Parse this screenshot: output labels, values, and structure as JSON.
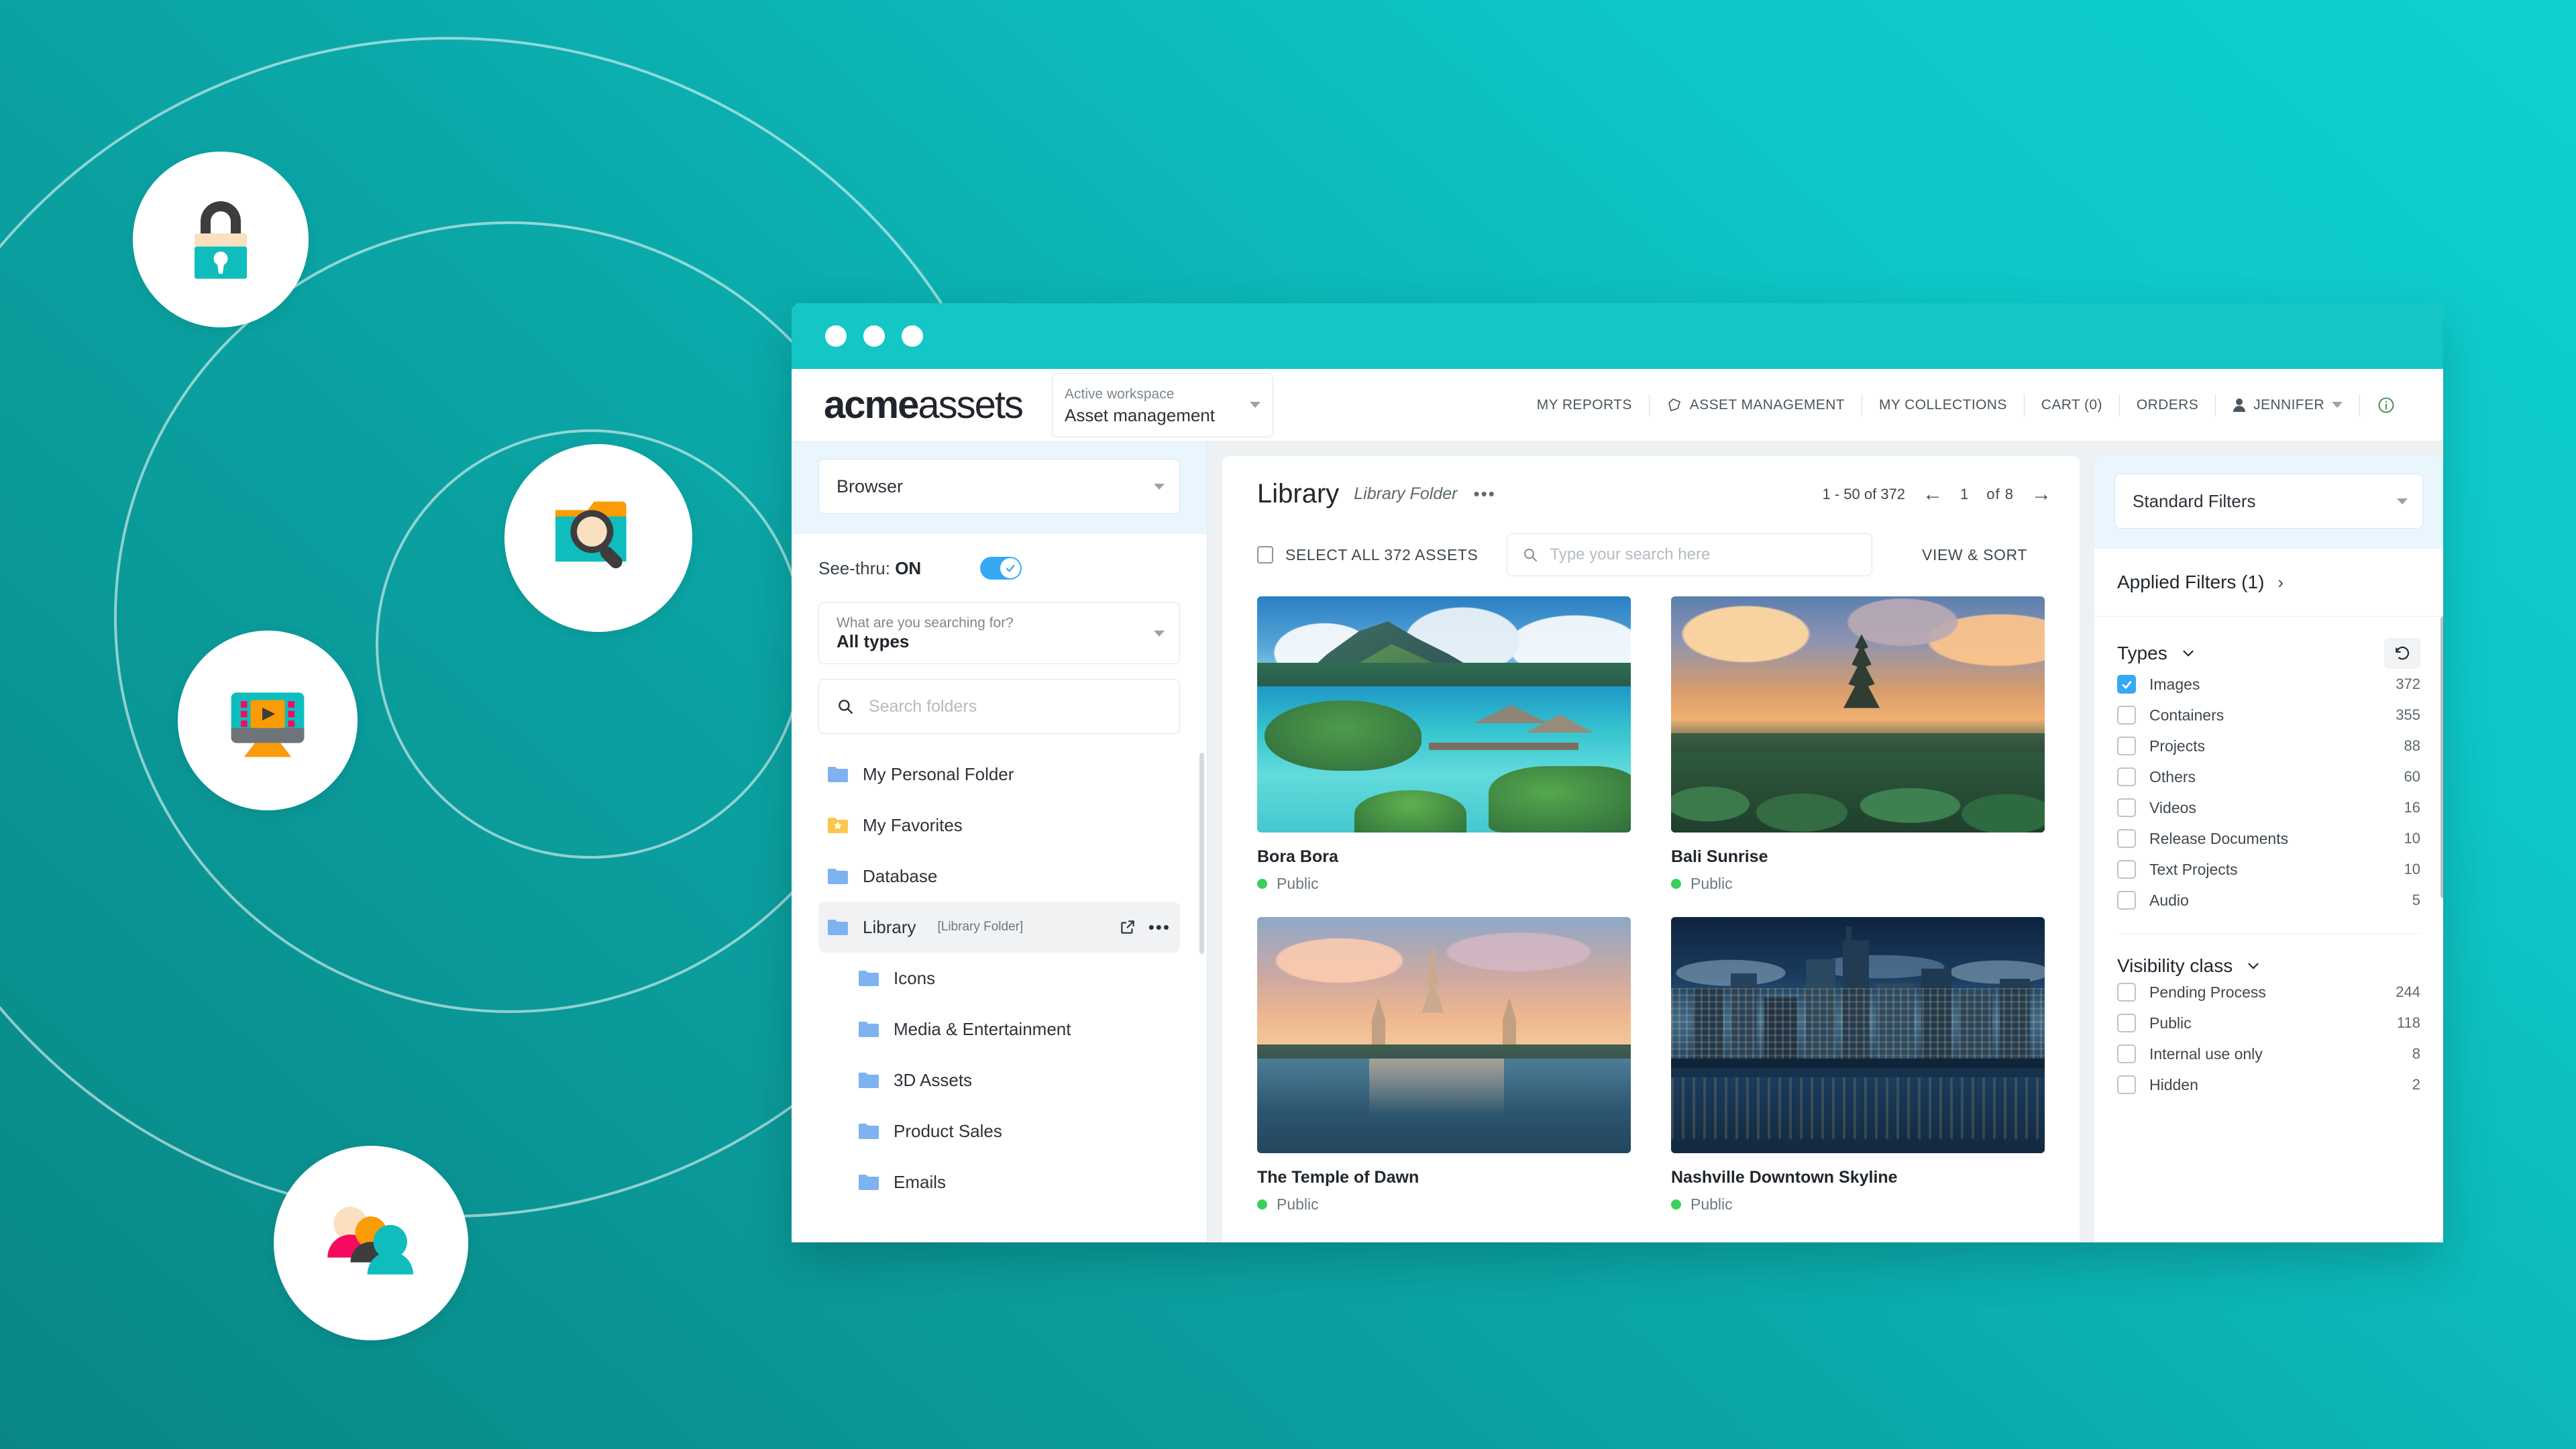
{
  "background": {
    "gradient_from": "#0a8686",
    "gradient_to": "#10cfcf",
    "accent_teal": "#14c6c6"
  },
  "badges": [
    {
      "name": "lock-icon",
      "label": "Secure access"
    },
    {
      "name": "folder-search-icon",
      "label": "Search assets"
    },
    {
      "name": "media-player-icon",
      "label": "Rich media"
    },
    {
      "name": "people-group-icon",
      "label": "Collaboration"
    }
  ],
  "window": {
    "traffic_lights": 3,
    "logo": {
      "bold": "acme",
      "light": "assets"
    },
    "workspace": {
      "label": "Active workspace",
      "value": "Asset management"
    },
    "topnav": [
      {
        "label": "MY REPORTS",
        "icon": null
      },
      {
        "label": "ASSET MANAGEMENT",
        "icon": "tag-icon"
      },
      {
        "label": "MY COLLECTIONS",
        "icon": null
      },
      {
        "label": "CART (0)",
        "icon": null
      },
      {
        "label": "ORDERS",
        "icon": null
      },
      {
        "label": "JENNIFER",
        "icon": "person-icon",
        "caret": true
      },
      {
        "label": "",
        "icon": "info-icon"
      }
    ]
  },
  "sidebar": {
    "browser_select": "Browser",
    "seethru": {
      "label": "See-thru:",
      "state": "ON",
      "on": true
    },
    "searchtype": {
      "question": "What are you searching for?",
      "value": "All types"
    },
    "folder_search_placeholder": "Search folders",
    "tree": [
      {
        "label": "My Personal Folder",
        "icon": "folder-icon",
        "depth": 0,
        "active": false
      },
      {
        "label": "My Favorites",
        "icon": "folder-star-icon",
        "depth": 0,
        "active": false
      },
      {
        "label": "Database",
        "icon": "folder-icon",
        "depth": 0,
        "active": false
      },
      {
        "label": "Library",
        "tag": "[Library Folder]",
        "icon": "folder-icon",
        "depth": 0,
        "active": true,
        "actions": [
          "external-link-icon",
          "more-icon"
        ]
      },
      {
        "label": "Icons",
        "icon": "folder-icon",
        "depth": 1,
        "active": false
      },
      {
        "label": "Media & Entertainment",
        "icon": "folder-icon",
        "depth": 1,
        "active": false
      },
      {
        "label": "3D Assets",
        "icon": "folder-icon",
        "depth": 1,
        "active": false
      },
      {
        "label": "Product Sales",
        "icon": "folder-icon",
        "depth": 1,
        "active": false
      },
      {
        "label": "Emails",
        "icon": "folder-icon",
        "depth": 1,
        "active": false
      }
    ]
  },
  "main": {
    "title": "Library",
    "kind": "Library Folder",
    "more": "•••",
    "range": "1 - 50 of 372",
    "page_current": "1",
    "page_of": "of 8",
    "select_all": "SELECT ALL 372 ASSETS",
    "search_placeholder": "Type your search here",
    "view_sort": "VIEW & SORT",
    "assets": [
      {
        "title": "Bora Bora",
        "visibility": "Public",
        "scene": "lagoon"
      },
      {
        "title": "Bali Sunrise",
        "visibility": "Public",
        "scene": "temple-sunrise"
      },
      {
        "title": "The Temple of Dawn",
        "visibility": "Public",
        "scene": "wat-arun"
      },
      {
        "title": "Nashville Downtown Skyline",
        "visibility": "Public",
        "scene": "skyline"
      }
    ]
  },
  "filters": {
    "preset": "Standard Filters",
    "applied": "Applied Filters (1)",
    "sections": [
      {
        "title": "Types",
        "reset_icon": "reset-icon",
        "rows": [
          {
            "label": "Images",
            "count": "372",
            "checked": true
          },
          {
            "label": "Containers",
            "count": "355",
            "checked": false
          },
          {
            "label": "Projects",
            "count": "88",
            "checked": false
          },
          {
            "label": "Others",
            "count": "60",
            "checked": false
          },
          {
            "label": "Videos",
            "count": "16",
            "checked": false
          },
          {
            "label": "Release Documents",
            "count": "10",
            "checked": false
          },
          {
            "label": "Text Projects",
            "count": "10",
            "checked": false
          },
          {
            "label": "Audio",
            "count": "5",
            "checked": false
          }
        ]
      },
      {
        "title": "Visibility class",
        "reset_icon": null,
        "rows": [
          {
            "label": "Pending Process",
            "count": "244",
            "checked": false
          },
          {
            "label": "Public",
            "count": "118",
            "checked": false
          },
          {
            "label": "Internal use only",
            "count": "8",
            "checked": false
          },
          {
            "label": "Hidden",
            "count": "2",
            "checked": false
          }
        ]
      }
    ]
  }
}
